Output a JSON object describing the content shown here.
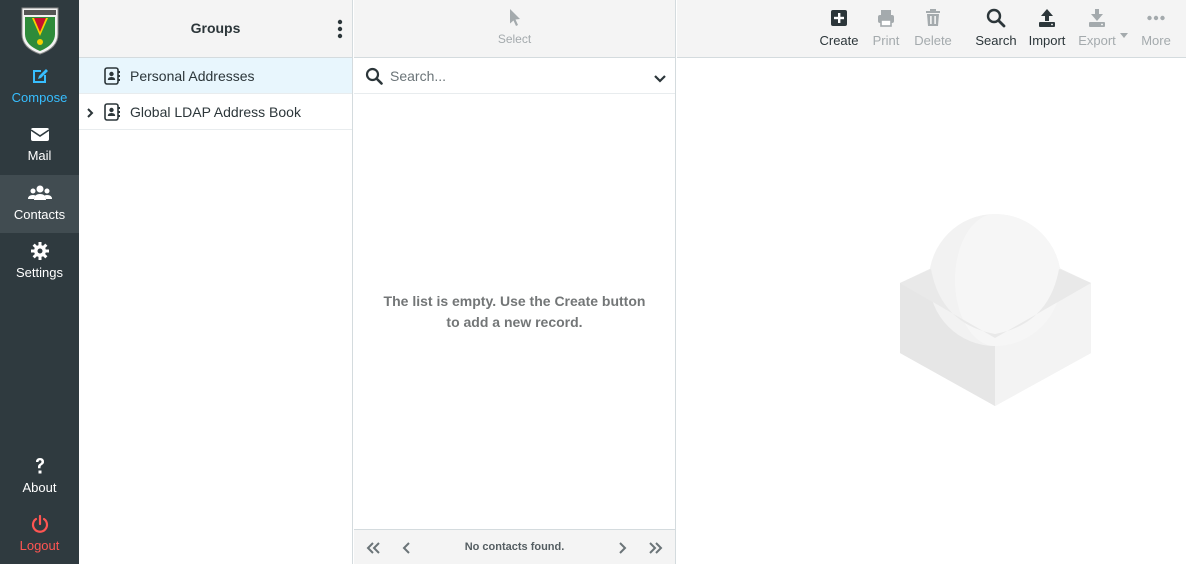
{
  "nav": {
    "compose": "Compose",
    "mail": "Mail",
    "contacts": "Contacts",
    "settings": "Settings",
    "about": "About",
    "logout": "Logout",
    "accent_color": "#37beff",
    "logout_color": "#ff5552"
  },
  "groups": {
    "title": "Groups",
    "items": [
      {
        "label": "Personal Addresses",
        "selected": true,
        "expandable": false
      },
      {
        "label": "Global LDAP Address Book",
        "selected": false,
        "expandable": true
      }
    ]
  },
  "list": {
    "select_label": "Select",
    "search_placeholder": "Search...",
    "empty_message_line1": "The list is empty. Use the Create button",
    "empty_message_line2": "to add a new record.",
    "pager_text": "No contacts found."
  },
  "toolbar": {
    "create": "Create",
    "print": "Print",
    "delete": "Delete",
    "search": "Search",
    "import": "Import",
    "export": "Export",
    "more": "More"
  }
}
